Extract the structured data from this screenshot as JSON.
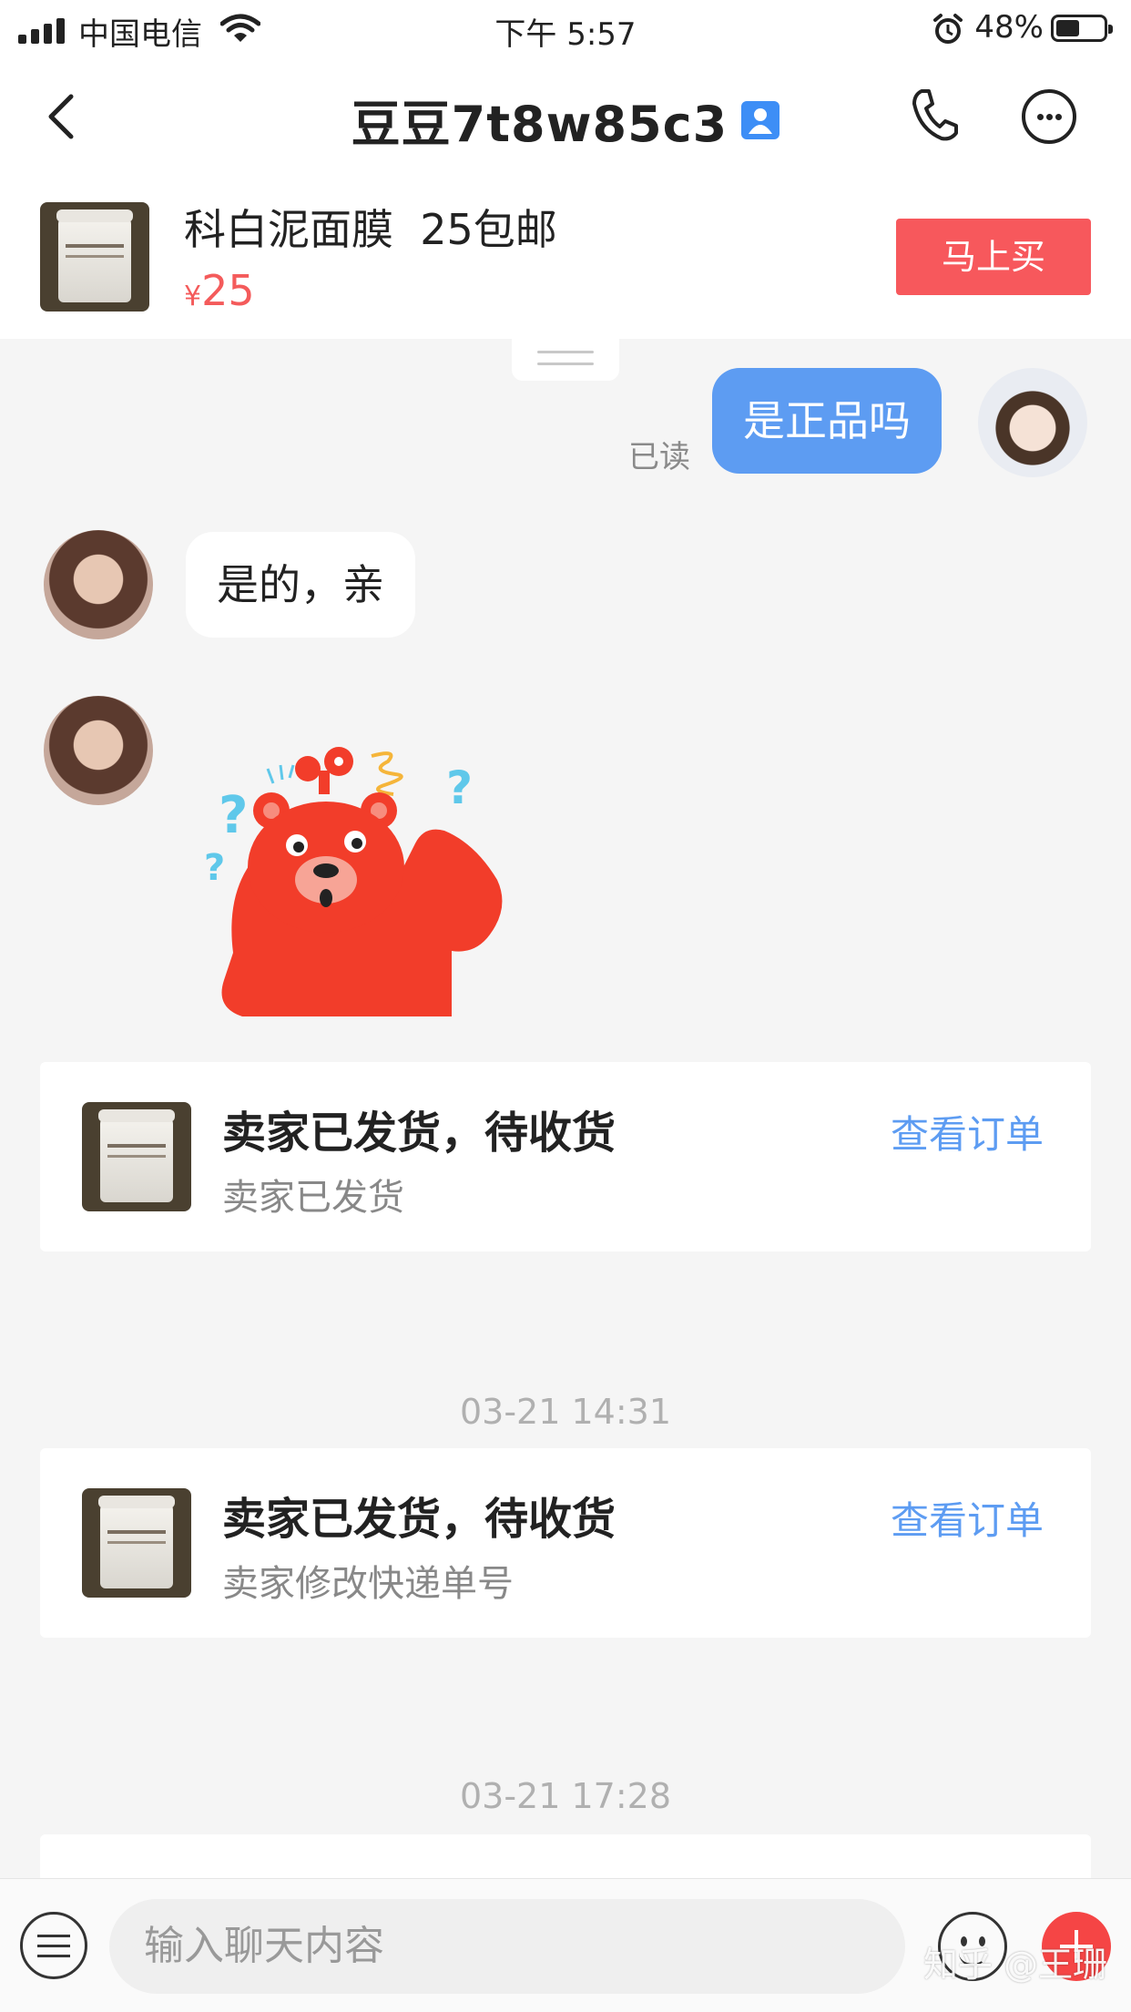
{
  "status_bar": {
    "carrier": "中国电信",
    "time": "下午 5:57",
    "battery": "48%",
    "battery_level": 0.48,
    "icons": [
      "signal-icon",
      "wifi-icon",
      "alarm-icon",
      "battery-icon"
    ]
  },
  "nav": {
    "title": "豆豆7t8w85c3",
    "icons": [
      "back-icon",
      "verified-icon",
      "phone-icon",
      "more-icon"
    ]
  },
  "product": {
    "title": "科白泥面膜  25包邮",
    "currency": "¥",
    "price": "25",
    "buy_label": "马上买"
  },
  "messages": {
    "me_text": "是正品吗",
    "me_status": "已读",
    "seller_text": "是的，亲"
  },
  "order_cards": [
    {
      "title": "卖家已发货，待收货",
      "subtitle": "卖家已发货",
      "link": "查看订单"
    },
    {
      "title": "卖家已发货，待收货",
      "subtitle": "卖家修改快递单号",
      "link": "查看订单"
    }
  ],
  "timestamps": [
    "03-21 14:31",
    "03-21 17:28"
  ],
  "input": {
    "placeholder": "输入聊天内容",
    "icons": [
      "menu-icon",
      "emoji-icon",
      "plus-icon"
    ]
  },
  "watermark": "知乎 @王珊",
  "colors": {
    "accent_blue": "#5d9cf2",
    "buy_red": "#f7585c",
    "price_red": "#f45b5b",
    "plus_red": "#f54545"
  }
}
